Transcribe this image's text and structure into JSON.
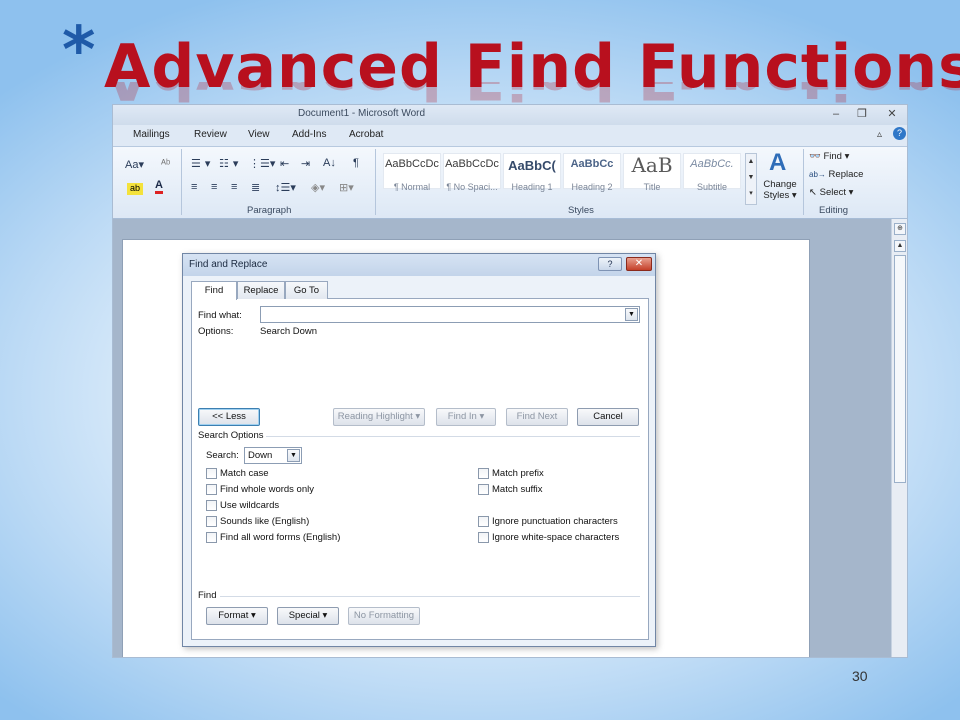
{
  "slide": {
    "star": "*",
    "title": "Advanced Find Functions",
    "page_number": "30"
  },
  "word": {
    "window_title": "Document1  -  Microsoft Word",
    "window_controls": [
      "–",
      "❐",
      "✕"
    ],
    "menu": [
      "Mailings",
      "Review",
      "View",
      "Add-Ins",
      "Acrobat"
    ],
    "ribbon": {
      "font_group_row1": "Aa▾",
      "font_color_glyph": "A",
      "paragraph_label": "Paragraph",
      "styles_label": "Styles",
      "editing_label": "Editing",
      "styles": [
        {
          "sample": "AaBbCcDc",
          "name": "¶ Normal"
        },
        {
          "sample": "AaBbCcDc",
          "name": "¶ No Spaci..."
        },
        {
          "sample": "AaBbC(",
          "name": "Heading 1"
        },
        {
          "sample": "AaBbCc",
          "name": "Heading 2"
        },
        {
          "sample": "AaB",
          "name": "Title"
        },
        {
          "sample": "AaBbCc.",
          "name": "Subtitle"
        }
      ],
      "change_styles": "Change Styles ▾",
      "change_styles_line1": "Change",
      "change_styles_line2": "Styles ▾",
      "find": "Find ▾",
      "replace": "Replace",
      "select": "Select ▾"
    }
  },
  "dialog": {
    "title": "Find and Replace",
    "help": "?",
    "close": "✕",
    "tabs": [
      "Find",
      "Replace",
      "Go To"
    ],
    "find_what_label": "Find what:",
    "find_what_value": "",
    "options_label": "Options:",
    "options_value": "Search Down",
    "buttons": {
      "less": "<< Less",
      "reading_highlight": "Reading Highlight ▾",
      "find_in": "Find In ▾",
      "find_next": "Find Next",
      "cancel": "Cancel"
    },
    "search_options_label": "Search Options",
    "search_label": "Search:",
    "search_value": "Down",
    "left_options": [
      {
        "label": "Match case",
        "checked": false
      },
      {
        "label": "Find whole words only",
        "checked": false
      },
      {
        "label": "Use wildcards",
        "checked": false
      },
      {
        "label": "Sounds like (English)",
        "checked": false
      },
      {
        "label": "Find all word forms (English)",
        "checked": false
      }
    ],
    "right_options": [
      {
        "label": "Match prefix",
        "checked": false
      },
      {
        "label": "Match suffix",
        "checked": false
      },
      {
        "label": "Ignore punctuation characters",
        "checked": false
      },
      {
        "label": "Ignore white-space characters",
        "checked": false
      }
    ],
    "find_section_label": "Find",
    "format_button": "Format ▾",
    "special_button": "Special ▾",
    "no_formatting_button": "No Formatting"
  }
}
